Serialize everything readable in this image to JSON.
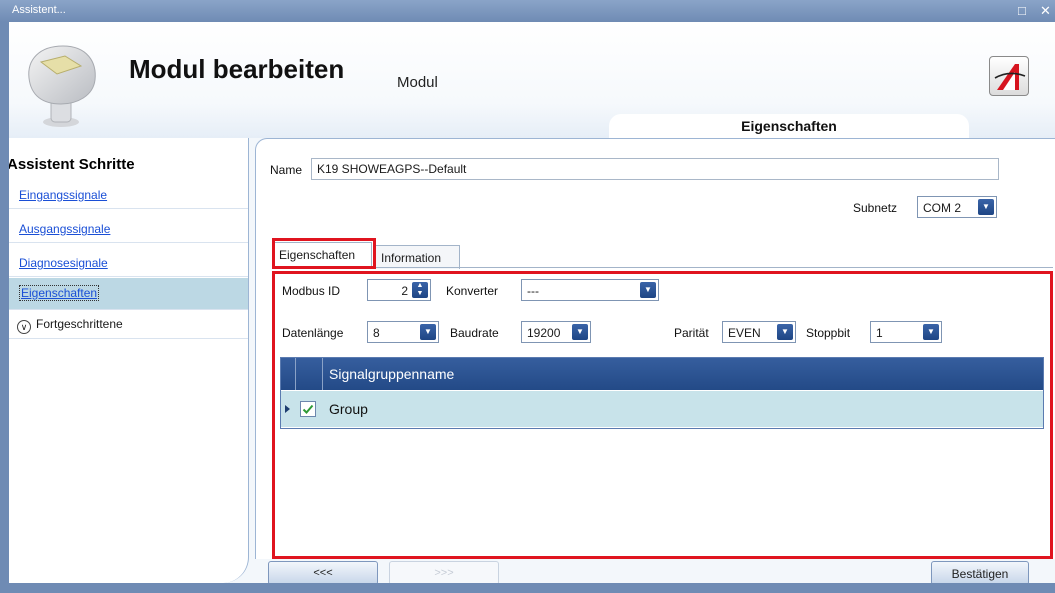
{
  "window": {
    "title": "Assistent..."
  },
  "header": {
    "title": "Modul bearbeiten",
    "subtitle": "Modul",
    "section_tab": "Eigenschaften"
  },
  "sidebar": {
    "heading": "Assistent Schritte",
    "steps": [
      {
        "label": "Eingangssignale"
      },
      {
        "label": "Ausgangssignale"
      },
      {
        "label": "Diagnosesignale"
      },
      {
        "label": "Eigenschaften",
        "active": true
      }
    ],
    "advanced": "Fortgeschrittene"
  },
  "form": {
    "name_label": "Name",
    "name_value": "K19 SHOWEAGPS--Default",
    "subnet_label": "Subnetz",
    "subnet_value": "COM 2"
  },
  "tabs": [
    {
      "label": "Eigenschaften",
      "active": true
    },
    {
      "label": "Information"
    }
  ],
  "properties": {
    "modbus_id_label": "Modbus ID",
    "modbus_id_value": "2",
    "converter_label": "Konverter",
    "converter_value": "---",
    "datalength_label": "Datenlänge",
    "datalength_value": "8",
    "baudrate_label": "Baudrate",
    "baudrate_value": "19200",
    "parity_label": "Parität",
    "parity_value": "EVEN",
    "stopbit_label": "Stoppbit",
    "stopbit_value": "1"
  },
  "grid": {
    "column": "Signalgruppenname",
    "rows": [
      {
        "name": "Group",
        "checked": true
      }
    ]
  },
  "footer": {
    "back": "<<<",
    "next": ">>>",
    "confirm": "Bestätigen"
  },
  "colors": {
    "highlight": "#e0141f",
    "grid_header": "#2d5593",
    "selected_row": "#c8e3ea",
    "link": "#1a4fd6"
  }
}
